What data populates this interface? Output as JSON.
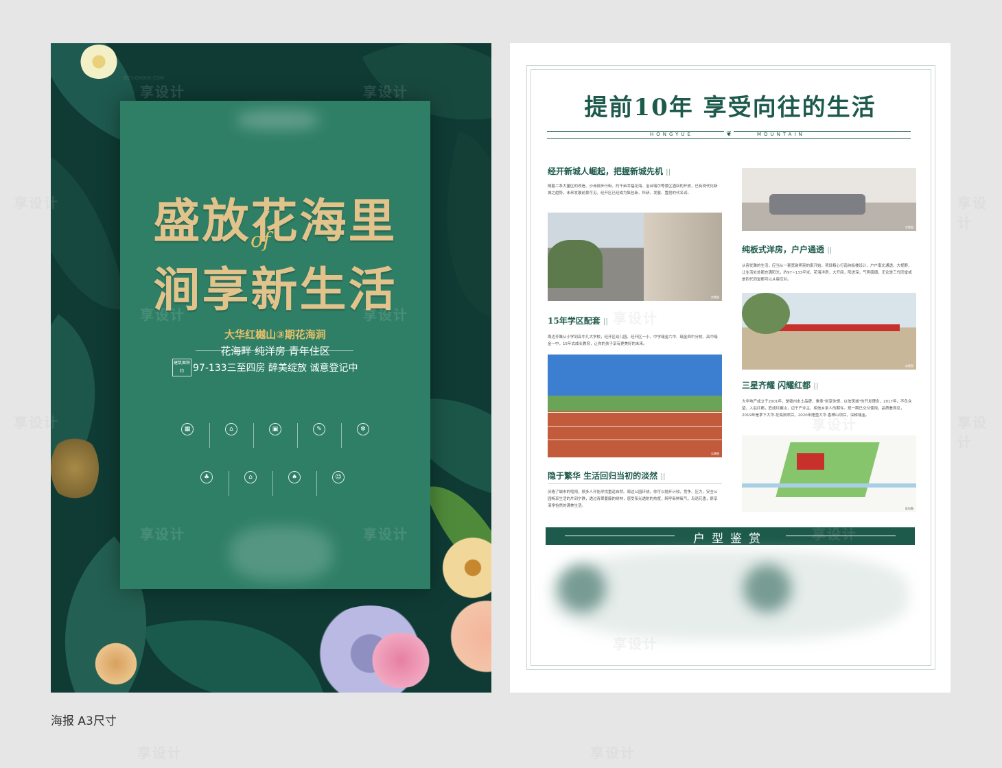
{
  "left_poster": {
    "headline_line1": "盛放花海里",
    "headline_line2": "涧享新生活",
    "script_overlay": "of",
    "project_name": "大华红樾山③期花海涧",
    "features": "花海畔   纯洋房   青年住区",
    "area_label": "建筑面积约",
    "area_text": "97-133三至四房  醉美绽放 诚意登记中",
    "icons_row1": [
      {
        "icon": "building-icon",
        "text": ""
      },
      {
        "icon": "house-icon",
        "text": ""
      },
      {
        "icon": "layout-icon",
        "text": ""
      },
      {
        "icon": "school-icon",
        "text": ""
      },
      {
        "icon": "gear-icon",
        "text": ""
      }
    ],
    "icons_row2": [
      {
        "icon": "tree-icon",
        "text": ""
      },
      {
        "icon": "home-icon",
        "text": ""
      },
      {
        "icon": "park-icon",
        "text": ""
      },
      {
        "icon": "family-icon",
        "text": ""
      }
    ]
  },
  "right_poster": {
    "main_title": "提前10年  享受向往的生活",
    "sub_left": "HONGYUE",
    "sub_right": "MOUNTAIN",
    "sections": [
      {
        "title": "经开新城人崛起，把握新城先机",
        "bars": "||",
        "text": "随着二系大量区的改造、沙洲部步行街、约千亩幸福花海、治台瑞尔等景区酒店的开放，已有现代化新城之趋势，未来发展前景可见。经开区已经成为集包新、科研、发展、置居的代名词。"
      },
      {
        "title": "15年学区配套",
        "bars": "||",
        "text": "周边齐聚从小学到高中几大学校，经开区幼儿园、经开区一小、中学瑞金六中、瑞金四中分校、高中瑞金一中，15年式成长教育，让你的孩子享有更美好的未来。"
      },
      {
        "title": "隐于繁华 生活回归当初的淡然",
        "bars": "||",
        "text": "厌倦了城市的喧闹，很多人开始寻找重返自然。周边公园环绕，你可以抛开计较，竞争、压力，安全公园畅享生活的片刻宁静，透过青翠蔓藤的树林，感受阳光透射的热度，醉呼新鲜氧气，鸟语花香，舒享清净怡然的满美生活。"
      },
      {
        "title": "纯板式洋房，户户通透",
        "bars": "||",
        "text": "从容优雅的生活，应当从一套宽敞明亮的家开始，项目精心打造纯板楼设计，户户南北通透，大视野，让生活处处都充满阳光，约97~133平米，花海洋房，大开间，阳进深，气势磅礴，无论是三代同堂或是四代同堂都可以从容应对。"
      },
      {
        "title": "三星齐耀 闪耀红都",
        "bars": "||",
        "text": "大华地产成立于2001年，是赣州本土品牌，秉承\"创享你想，以信筑城\"的开发理念，2017年，不负众望，入驻红都，匠成红樾山，迈于产业主，相信乡亲人的期许。现一期已交付使用，品质看得见，2019年是拿下大华·花海涧项目，2020年隆重大华·香樟山项目，深耕瑞金。"
      }
    ],
    "floorplan_title": "户型鉴赏",
    "photo_caption": "实景图",
    "map_caption": "区位图"
  },
  "watermark": {
    "brand": "享设计",
    "domain": "DESIGN006.COM"
  },
  "footer_caption": "海报 A3尺寸",
  "colors": {
    "background": "#e6e6e6",
    "poster_dark_green": "#0f3b34",
    "card_green": "#2f7f66",
    "gold": "#e2c38c",
    "heading_green": "#1d5a4b"
  }
}
